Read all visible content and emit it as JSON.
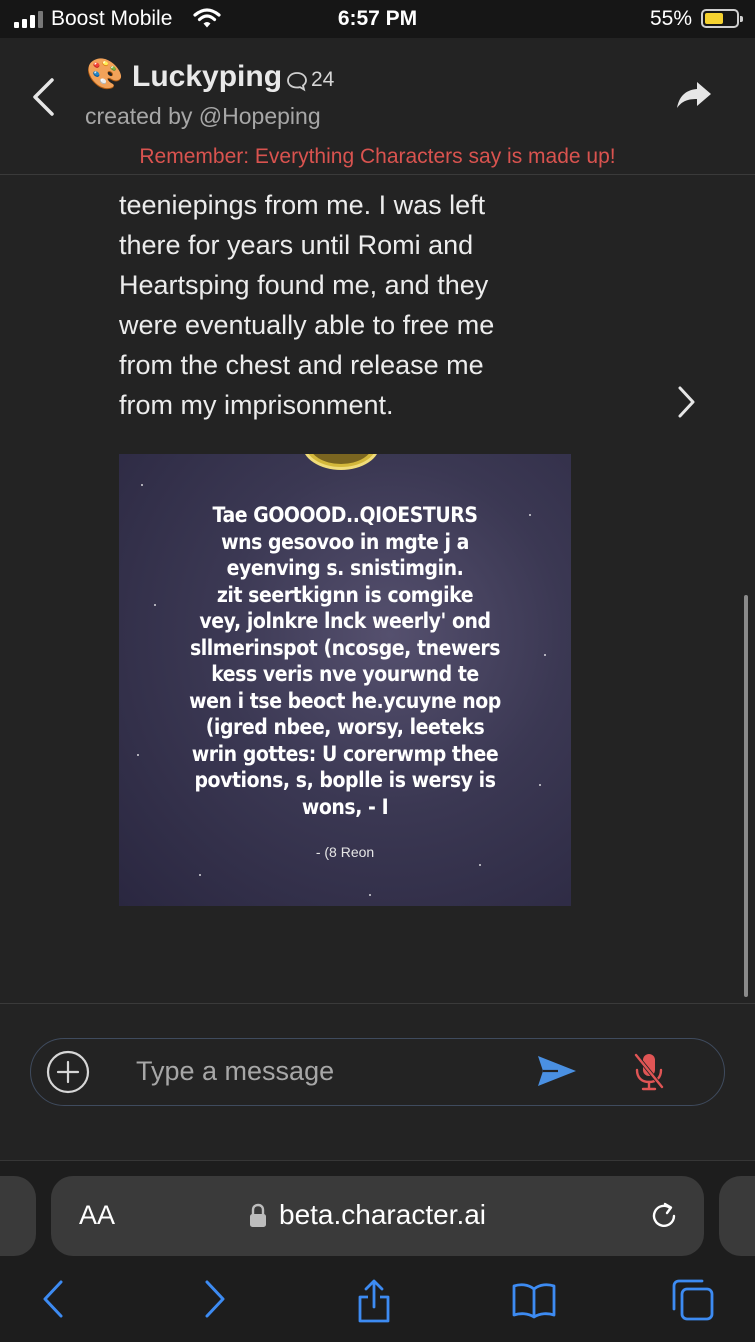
{
  "status_bar": {
    "carrier": "Boost Mobile",
    "time": "6:57 PM",
    "battery": "55%",
    "battery_level": 0.55
  },
  "header": {
    "avatar_icon": "palette-emoji",
    "title": "Luckyping",
    "chat_count": "24",
    "creator": "created by @Hopeping",
    "disclaimer": "Remember: Everything Characters say is made up!"
  },
  "message": {
    "lines": [
      "teeniepings from me. I was left",
      "there for years until Romi and",
      "Heartsping found me, and they",
      "were eventually able to free me",
      "from the chest and release me",
      "from my imprisonment."
    ],
    "image_text": [
      "Tae GOOOOD..QIOESTURS",
      "wns gesovoo in mgte j a",
      "eyenving s. snistimgin.",
      "zit seertkignn is comgike",
      "vey, jolnkre lnck weerly' ond",
      "sllmerinspot (ncosge, tnewers",
      "kess veris nve yourwnd te",
      "wen i tse beoct he.ycuyne nop",
      "(igred nbee, worsy, leeteks",
      "wrin gottes: U corerwmp thee",
      "povtions, s, boplle is wersy is",
      "wons, - I"
    ],
    "image_signature": "- (8 Reon"
  },
  "composer": {
    "placeholder": "Type a message"
  },
  "browser": {
    "text_size_label": "AA",
    "url": "beta.character.ai"
  },
  "colors": {
    "accent": "#4a90e2",
    "disclaimer": "#d9534f",
    "mic_muted": "#e05555",
    "background": "#232323"
  }
}
